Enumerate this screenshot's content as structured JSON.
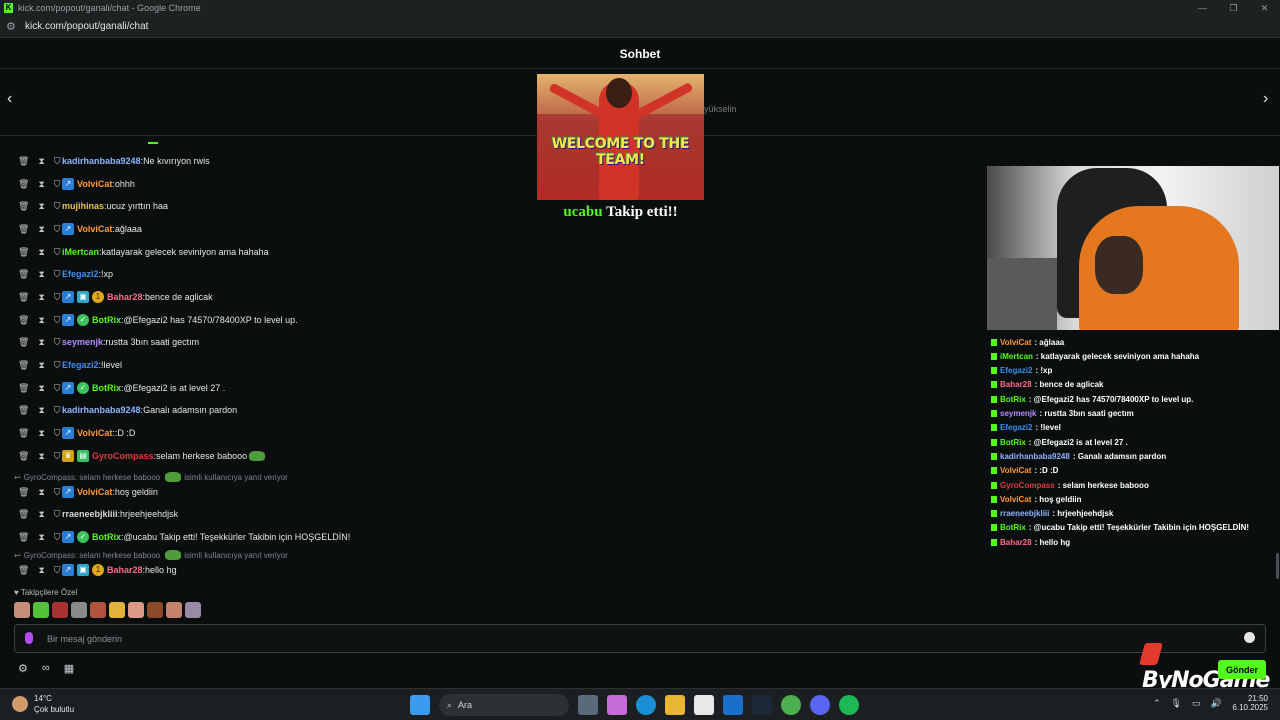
{
  "window": {
    "title": "kick.com/popout/ganali/chat - Google Chrome",
    "url": "kick.com/popout/ganali/chat"
  },
  "chat": {
    "header": "Sohbet",
    "pinned_side_text": "yükselin",
    "alert": {
      "gif_text": "WELCOME TO THE TEAM!",
      "user": "ucabu",
      "action": "Takip etti!!"
    },
    "messages": [
      {
        "user": "kadirhanbaba9248",
        "color": "#8fb4ff",
        "badges": [],
        "text": "Ne kıvırıyon rwis"
      },
      {
        "user": "VolviCat",
        "color": "#ff9a3c",
        "badges": [
          "arrow"
        ],
        "text": "ohhh"
      },
      {
        "user": "mujihinas",
        "color": "#e7c34a",
        "badges": [],
        "text": "ucuz yırttın haa"
      },
      {
        "user": "VolviCat",
        "color": "#ff9a3c",
        "badges": [
          "arrow"
        ],
        "text": "ağlaaa"
      },
      {
        "user": "iMertcan",
        "color": "#53fc18",
        "badges": [],
        "text": "katlayarak gelecek seviniyon ama hahaha"
      },
      {
        "user": "Efegazi2",
        "color": "#3c8df0",
        "badges": [],
        "text": "!xp"
      },
      {
        "user": "Bahar28",
        "color": "#ff6b8b",
        "badges": [
          "arrow",
          "sub",
          "coin"
        ],
        "text": "bence de aglicak"
      },
      {
        "user": "BotRix",
        "color": "#53fc18",
        "badges": [
          "arrow",
          "bot"
        ],
        "text": "@Efegazi2 has 74570/78400XP to level up."
      },
      {
        "user": "seymenjk",
        "color": "#b58cff",
        "badges": [],
        "text": "rustta 3bın saati gectım"
      },
      {
        "user": "Efegazi2",
        "color": "#3c8df0",
        "badges": [],
        "text": "!level"
      },
      {
        "user": "BotRix",
        "color": "#53fc18",
        "badges": [
          "arrow",
          "bot"
        ],
        "text": "@Efegazi2 is at level 27 ."
      },
      {
        "user": "kadirhanbaba9248",
        "color": "#8fb4ff",
        "badges": [],
        "text": "Ganalı adamsın pardon"
      },
      {
        "user": "VolviCat",
        "color": "#ff9a3c",
        "badges": [
          "arrow"
        ],
        "text": ":D :D"
      },
      {
        "user": "GyroCompass",
        "color": "#e03a3a",
        "badges": [
          "crown",
          "gift"
        ],
        "text": "selam herkese babooo"
      },
      {
        "user": "VolviCat",
        "color": "#ff9a3c",
        "badges": [
          "arrow"
        ],
        "text": "hoş geldiin"
      },
      {
        "user": "rraeneebjkliii",
        "color": "#d7d7d7",
        "badges": [],
        "text": "hrjeehjeehdjsk"
      },
      {
        "user": "BotRix",
        "color": "#53fc18",
        "badges": [
          "arrow",
          "bot"
        ],
        "text": "@ucabu Takip etti! Teşekkürler Takibin için HOŞGELDİN!"
      },
      {
        "user": "Bahar28",
        "color": "#ff6b8b",
        "badges": [
          "arrow",
          "sub",
          "coin"
        ],
        "text": "hello hg"
      }
    ],
    "reply_1": {
      "text": "GyroCompass: selam herkese babooo",
      "suffix": "isimli kullanıcıya yanıt veriyor"
    },
    "reply_2": {
      "text": "GyroCompass: selam herkese babooo",
      "suffix": "isimli kullanıcıya yanıt veriyor"
    },
    "followers_label": "Takipçilere Özel",
    "input_placeholder": "Bir mesaj gönderin",
    "send_label": "Gönder"
  },
  "overlay": {
    "brand": "ByNoGame",
    "messages": [
      {
        "user": "VolviCat",
        "color": "#ff9a3c",
        "text": ": ağlaaa"
      },
      {
        "user": "iMertcan",
        "color": "#53fc18",
        "text": ": katlayarak gelecek seviniyon ama hahaha"
      },
      {
        "user": "Efegazi2",
        "color": "#3c8df0",
        "text": ": !xp"
      },
      {
        "user": "Bahar28",
        "color": "#ff6b8b",
        "text": ": bence de aglicak"
      },
      {
        "user": "BotRix",
        "color": "#53fc18",
        "text": ": @Efegazi2 has 74570/78400XP to level up."
      },
      {
        "user": "seymenjk",
        "color": "#b58cff",
        "text": ": rustta 3bın saati gectım"
      },
      {
        "user": "Efegazi2",
        "color": "#3c8df0",
        "text": ": !level"
      },
      {
        "user": "BotRix",
        "color": "#53fc18",
        "text": ": @Efegazi2 is at level 27 ."
      },
      {
        "user": "kadirhanbaba9248",
        "color": "#8fb4ff",
        "text": ": Ganalı adamsın pardon"
      },
      {
        "user": "VolviCat",
        "color": "#ff9a3c",
        "text": ": :D :D"
      },
      {
        "user": "GyroCompass",
        "color": "#e03a3a",
        "text": ": selam herkese babooo"
      },
      {
        "user": "VolviCat",
        "color": "#ff9a3c",
        "text": ": hoş geldiin"
      },
      {
        "user": "rraeneebjkliii",
        "color": "#8fb4ff",
        "text": ": hrjeehjeehdjsk"
      },
      {
        "user": "BotRix",
        "color": "#53fc18",
        "text": ": @ucabu Takip etti! Teşekkürler Takibin için HOŞGELDİN!"
      },
      {
        "user": "Bahar28",
        "color": "#ff6b8b",
        "text": ": hello hg"
      }
    ]
  },
  "taskbar": {
    "temperature": "14°C",
    "weather": "Çok bulutlu",
    "search_label": "Ara",
    "time": "21:50",
    "date": "6.10.2025"
  }
}
